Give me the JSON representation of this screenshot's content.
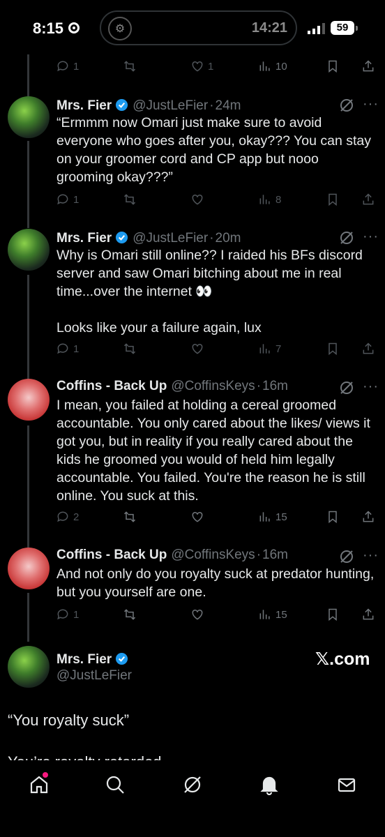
{
  "status_bar": {
    "time": "8:15",
    "island_time": "14:21",
    "battery": "59"
  },
  "top_actions": {
    "replies": "1",
    "likes": "1",
    "views": "10"
  },
  "tweets": [
    {
      "name": "Mrs. Fier",
      "handle": "@JustLeFier",
      "time": "24m",
      "text": "“Ermmm now Omari just make sure to avoid everyone who goes after you, okay??? You can stay on your groomer cord and CP app but nooo grooming okay???”",
      "replies": "1",
      "views": "8"
    },
    {
      "name": "Mrs. Fier",
      "handle": "@JustLeFier",
      "time": "20m",
      "text": "Why is Omari still online?? I raided his BFs discord server and saw Omari bitching about me in real time...over the internet 👀\n\nLooks like your a failure again, lux",
      "replies": "1",
      "views": "7"
    },
    {
      "name": "Coffins - Back Up",
      "handle": "@CoffinsKeys",
      "time": "16m",
      "text": "I mean, you failed at holding a cereal groomed accountable. You only cared about the likes/ views it got you, but in reality if you really cared about the kids he groomed you would of held him legally accountable. You failed. You're the reason he is still online. You suck at this.",
      "replies": "2",
      "views": "15"
    },
    {
      "name": "Coffins - Back Up",
      "handle": "@CoffinsKeys",
      "time": "16m",
      "text": "And not only do you royalty suck at predator hunting, but you yourself are one.",
      "replies": "1",
      "views": "15"
    }
  ],
  "card": {
    "name": "Mrs. Fier",
    "handle": "@JustLeFier",
    "brand": "𝕏.com",
    "quote1": "“You royalty suck”",
    "quote2": "You’re royalty retarded"
  },
  "nav": [
    "home-icon",
    "search-icon",
    "grok-icon",
    "notifications-icon",
    "messages-icon"
  ],
  "colors": {
    "background": "#000000",
    "text": "#e7e9ea",
    "muted": "#71767b",
    "verified": "#1d9bf0",
    "notification_dot": "#f91880"
  }
}
